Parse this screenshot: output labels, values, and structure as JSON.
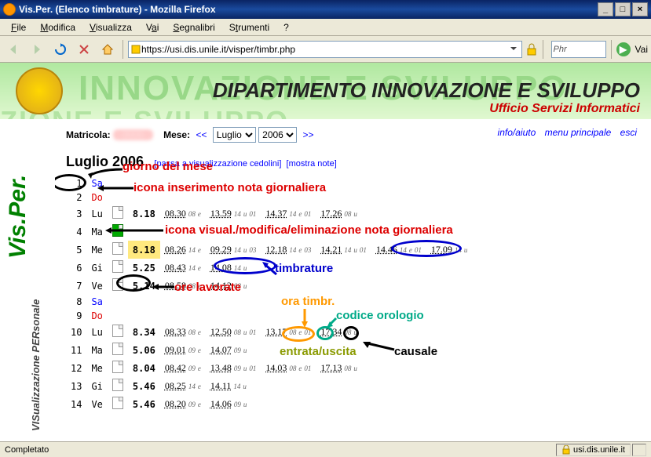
{
  "window": {
    "title": "Vis.Per. (Elenco timbrature) - Mozilla Firefox",
    "min": "_",
    "max": "□",
    "close": "×"
  },
  "menu": {
    "file": "File",
    "modifica": "Modifica",
    "visualizza": "Visualizza",
    "vai": "Vai",
    "segnalibri": "Segnalibri",
    "strumenti": "Strumenti",
    "help": "?"
  },
  "toolbar": {
    "url": "https://usi.dis.unile.it/visper/timbr.php",
    "go": "Vai",
    "searchPlaceholder": "Phr"
  },
  "header": {
    "bg1": "INNOVAZIONE E SVILUPPO",
    "bg2": "ZIONE E SVILUPPO",
    "title": "DIPARTIMENTO INNOVAZIONE E SVILUPPO",
    "subtitle": "Ufficio Servizi Informatici",
    "side_main": "Vis.Per.",
    "side_sub": "VISualizzazione PERsonale"
  },
  "selrow": {
    "matricola_label": "Matricola:",
    "mese_label": "Mese:",
    "prev": "<<",
    "next": ">>",
    "month": "Luglio",
    "year": "2006",
    "link_info": "info/aiuto",
    "link_menu": "menu principale",
    "link_esci": "esci"
  },
  "heading": {
    "month": "Luglio 2006",
    "link1": "passa a visualizzazione cedolini",
    "link2": "mostra note"
  },
  "annotations": {
    "giorno": "giorno del mese",
    "icona_ins": "icona inserimento nota giornaliera",
    "icona_mod": "icona visual./modifica/eliminazione nota giornaliera",
    "timbrature": "timbrature",
    "ore_lavorate": "ore lavorate",
    "ora_timbr": "ora timbr.",
    "codice": "codice orologio",
    "entrata": "entrata/uscita",
    "causale": "causale"
  },
  "days": [
    {
      "n": "1",
      "dw": "Sa",
      "cls": "sa"
    },
    {
      "n": "2",
      "dw": "Do",
      "cls": "do"
    },
    {
      "n": "3",
      "dw": "Lu",
      "cls": "",
      "note": "e",
      "hrs": "8.18",
      "stamps": [
        [
          "08.30",
          "08",
          "e"
        ],
        [
          "13.59",
          "14",
          "u",
          "01"
        ],
        [
          "14.37",
          "14",
          "e",
          "01"
        ],
        [
          "17.26",
          "08",
          "u"
        ]
      ]
    },
    {
      "n": "4",
      "dw": "Ma",
      "cls": "",
      "note": "f"
    },
    {
      "n": "5",
      "dw": "Me",
      "cls": "",
      "note": "e",
      "hrs": "8.18",
      "hl": true,
      "stamps": [
        [
          "08.26",
          "14",
          "e"
        ],
        [
          "09.29",
          "14",
          "u",
          "03"
        ],
        [
          "12.18",
          "14",
          "e",
          "03"
        ],
        [
          "14.21",
          "14",
          "u",
          "01"
        ],
        [
          "14.46",
          "14",
          "e",
          "01"
        ],
        [
          "17.09",
          "14",
          "u"
        ]
      ]
    },
    {
      "n": "6",
      "dw": "Gi",
      "cls": "",
      "note": "e",
      "hrs": "5.25",
      "stamps": [
        [
          "08.43",
          "14",
          "e"
        ],
        [
          "14.08",
          "14",
          "u"
        ]
      ]
    },
    {
      "n": "7",
      "dw": "Ve",
      "cls": "",
      "note": "e",
      "hrs": "5.14",
      "stamps": [
        [
          "08.58",
          "08",
          "e"
        ],
        [
          "14.12",
          "08",
          "u"
        ]
      ]
    },
    {
      "n": "8",
      "dw": "Sa",
      "cls": "sa"
    },
    {
      "n": "9",
      "dw": "Do",
      "cls": "do"
    },
    {
      "n": "10",
      "dw": "Lu",
      "cls": "",
      "note": "e",
      "hrs": "8.34",
      "stamps": [
        [
          "08.33",
          "08",
          "e"
        ],
        [
          "12.50",
          "08",
          "u",
          "01"
        ],
        [
          "13.17",
          "08",
          "e",
          "01"
        ],
        [
          "17.34",
          "08",
          "u"
        ]
      ]
    },
    {
      "n": "11",
      "dw": "Ma",
      "cls": "",
      "note": "e",
      "hrs": "5.06",
      "stamps": [
        [
          "09.01",
          "09",
          "e"
        ],
        [
          "14.07",
          "09",
          "u"
        ]
      ]
    },
    {
      "n": "12",
      "dw": "Me",
      "cls": "",
      "note": "e",
      "hrs": "8.04",
      "stamps": [
        [
          "08.42",
          "09",
          "e"
        ],
        [
          "13.48",
          "09",
          "u",
          "01"
        ],
        [
          "14.03",
          "08",
          "e",
          "01"
        ],
        [
          "17.13",
          "08",
          "u"
        ]
      ]
    },
    {
      "n": "13",
      "dw": "Gi",
      "cls": "",
      "note": "e",
      "hrs": "5.46",
      "stamps": [
        [
          "08.25",
          "14",
          "e"
        ],
        [
          "14.11",
          "14",
          "u"
        ]
      ]
    },
    {
      "n": "14",
      "dw": "Ve",
      "cls": "",
      "note": "e",
      "hrs": "5.46",
      "stamps": [
        [
          "08.20",
          "09",
          "e"
        ],
        [
          "14.06",
          "09",
          "u"
        ]
      ]
    }
  ],
  "status": {
    "left": "Completato",
    "domain": "usi.dis.unile.it"
  }
}
